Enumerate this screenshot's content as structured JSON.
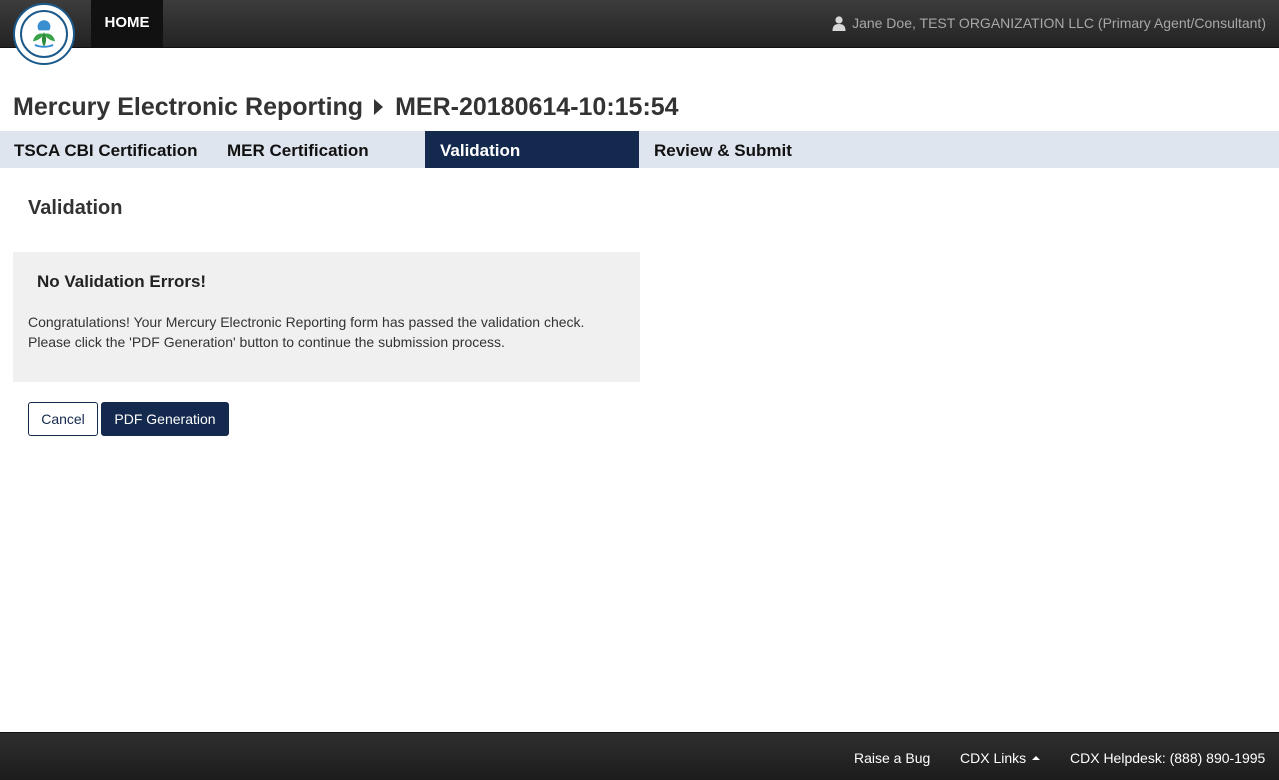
{
  "header": {
    "home_label": "HOME",
    "user_label": "Jane Doe, TEST ORGANIZATION LLC (Primary Agent/Consultant)",
    "user_icon": "user-icon",
    "logo_icon": "epa-seal-logo"
  },
  "page": {
    "app_title": "Mercury Electronic Reporting",
    "record_id": "MER-20180614-10:15:54"
  },
  "tabs": [
    {
      "label": "TSCA CBI Certification",
      "active": false
    },
    {
      "label": "MER Certification",
      "active": false
    },
    {
      "label": "Validation",
      "active": true
    },
    {
      "label": "Review & Submit",
      "active": false
    }
  ],
  "main": {
    "section_title": "Validation",
    "message_heading": "No Validation Errors!",
    "message_line1": "Congratulations! Your Mercury Electronic Reporting form has passed the validation check.",
    "message_line2": "Please click the 'PDF Generation' button to continue the submission process."
  },
  "buttons": {
    "cancel_label": "Cancel",
    "pdf_label": "PDF Generation"
  },
  "footer": {
    "raise_bug": "Raise a Bug",
    "cdx_links": "CDX Links",
    "helpdesk": "CDX Helpdesk: (888) 890-1995"
  },
  "colors": {
    "navy": "#13294d",
    "tab_bar": "#dfe5ee",
    "message_bg": "#f0f0f0"
  }
}
